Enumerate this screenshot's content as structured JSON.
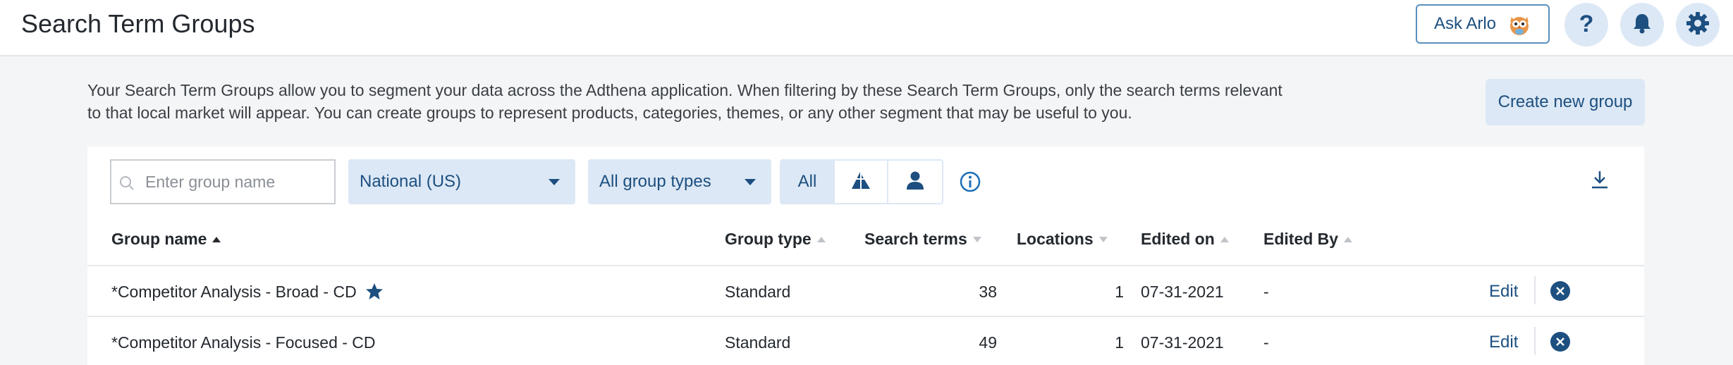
{
  "header": {
    "title": "Search Term Groups",
    "ask_arlo_label": "Ask Arlo"
  },
  "intro": {
    "text": "Your Search Term Groups allow you to segment your data across the Adthena application. When filtering by these Search Term Groups, only the search terms relevant to that local market will appear. You can create groups to represent products, categories, themes, or any other segment that may be useful to you."
  },
  "create_button_label": "Create new group",
  "filters": {
    "search_placeholder": "Enter group name",
    "market": "National (US)",
    "group_type": "All group types",
    "toggle": {
      "all_label": "All",
      "selected": "All",
      "options": [
        "all",
        "market-icon",
        "user-icon"
      ]
    }
  },
  "table": {
    "columns": [
      "Group name",
      "Group type",
      "Search terms",
      "Locations",
      "Edited on",
      "Edited By"
    ],
    "sorted_column": "Group name",
    "sort_direction": "ascending",
    "rows": [
      {
        "name": "*Competitor Analysis - Broad - CD",
        "starred": true,
        "type": "Standard",
        "search_terms": "38",
        "locations": "1",
        "edited_on": "07-31-2021",
        "edited_by": "-",
        "edit_label": "Edit"
      },
      {
        "name": "*Competitor Analysis - Focused - CD",
        "starred": false,
        "type": "Standard",
        "search_terms": "49",
        "locations": "1",
        "edited_on": "07-31-2021",
        "edited_by": "-",
        "edit_label": "Edit"
      }
    ]
  },
  "icons": [
    "help-icon",
    "bell-icon",
    "settings-icon",
    "search-icon",
    "chevron-down-icon",
    "info-icon",
    "download-icon",
    "star-icon",
    "close-icon",
    "owl-icon"
  ],
  "colors": {
    "accent": "#1d4f80",
    "accent_light": "#dce8f5",
    "annotation_arrow": "#e8472c"
  }
}
